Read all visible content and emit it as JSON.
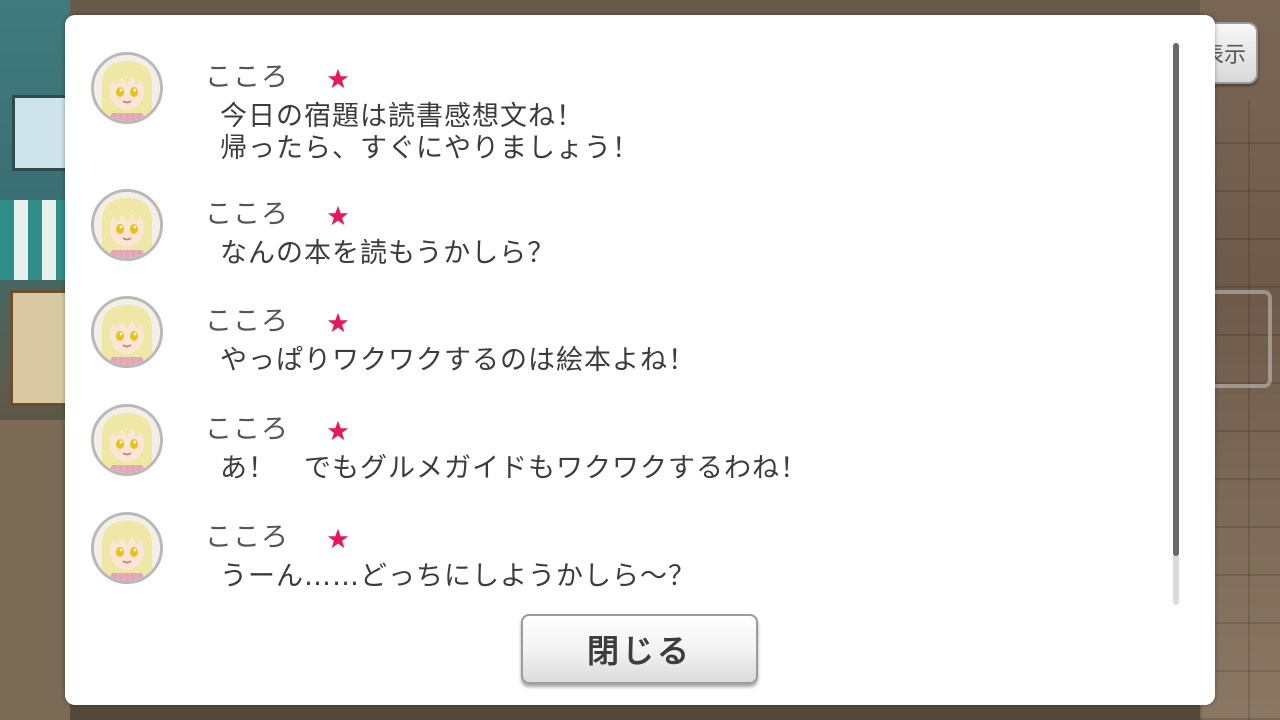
{
  "background": {
    "display_button_label": "表示"
  },
  "dialog": {
    "entries": [
      {
        "speaker": "こころ",
        "lines": [
          "今日の宿題は読書感想文ね！",
          "帰ったら、すぐにやりましょう！"
        ]
      },
      {
        "speaker": "こころ",
        "lines": [
          "なんの本を読もうかしら？"
        ]
      },
      {
        "speaker": "こころ",
        "lines": [
          "やっぱりワクワクするのは絵本よね！"
        ]
      },
      {
        "speaker": "こころ",
        "lines": [
          "あ！　でもグルメガイドもワクワクするわね！"
        ]
      },
      {
        "speaker": "こころ",
        "lines": [
          "うーん……どっちにしようかしら～？"
        ]
      }
    ],
    "close_label": "閉じる"
  },
  "colors": {
    "star": "#e4195a",
    "avatar_hair": "#efe7a6",
    "avatar_ring": "#b9b9b9"
  }
}
